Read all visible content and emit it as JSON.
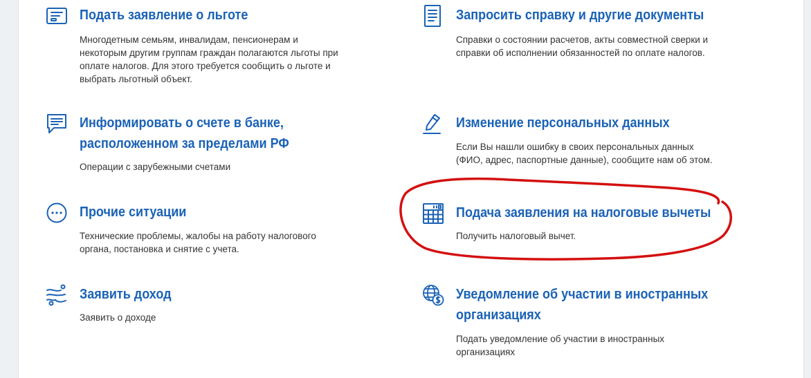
{
  "colors": {
    "accent": "#1a62b6",
    "text": "#333333",
    "annotation": "#d41010"
  },
  "items": [
    {
      "id": "benefit",
      "icon": "document-form-icon",
      "title_lines": [
        "Подать заявление о льготе"
      ],
      "desc_lines": [
        "Многодетным семьям, инвалидам, пенсионерам и",
        "некоторым другим группам граждан полагаются льготы при",
        "оплате налогов. Для этого требуется сообщить о льготе и",
        "выбрать льготный объект."
      ]
    },
    {
      "id": "certificate",
      "icon": "document-list-icon",
      "title_lines": [
        "Запросить справку и другие документы"
      ],
      "desc_lines": [
        "Справки о состоянии расчетов, акты совместной сверки и",
        "справки об исполнении обязанностей по оплате налогов."
      ]
    },
    {
      "id": "foreign-bank",
      "icon": "message-icon",
      "title_lines": [
        "Информировать о счете в банке,",
        "расположенном за пределами РФ"
      ],
      "desc_lines": [
        "Операции с зарубежными счетами"
      ]
    },
    {
      "id": "personal-data",
      "icon": "pencil-icon",
      "title_lines": [
        "Изменение персональных данных"
      ],
      "desc_lines": [
        "Если Вы нашли ошибку в своих персональных данных",
        "(ФИО, адрес, паспортные данные), сообщите нам об этом."
      ]
    },
    {
      "id": "other",
      "icon": "ellipsis-circle-icon",
      "title_lines": [
        "Прочие ситуации"
      ],
      "desc_lines": [
        "Технические проблемы, жалобы на работу налогового",
        "органа, постановка и снятие с учета."
      ]
    },
    {
      "id": "deductions",
      "icon": "calculator-icon",
      "title_lines": [
        "Подача заявления на налоговые вычеты"
      ],
      "desc_lines": [
        "Получить налоговый вычет."
      ]
    },
    {
      "id": "income",
      "icon": "money-flow-icon",
      "title_lines": [
        "Заявить доход"
      ],
      "desc_lines": [
        "Заявить о доходе"
      ]
    },
    {
      "id": "foreign-org",
      "icon": "globe-dollar-icon",
      "title_lines": [
        "Уведомление об участии в иностранных",
        "организациях"
      ],
      "desc_lines": [
        "Подать уведомление об участии в иностранных",
        "организациях"
      ]
    }
  ]
}
